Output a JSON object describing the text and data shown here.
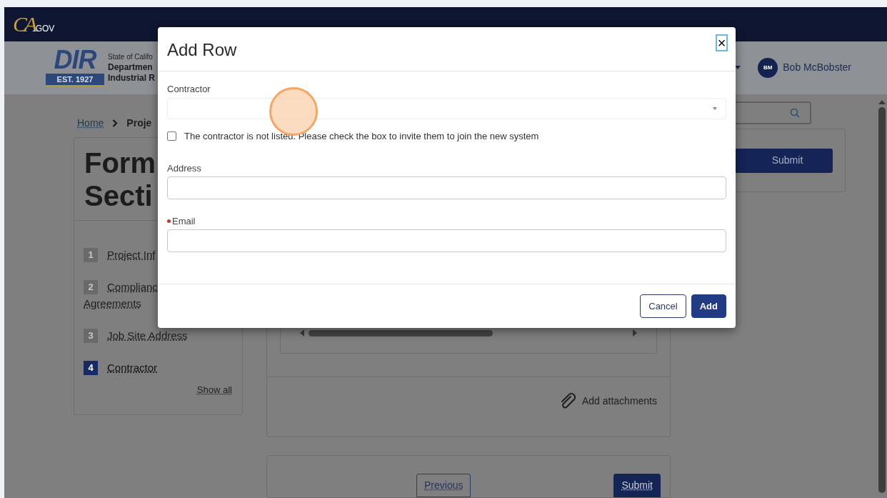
{
  "top_bar": {
    "logo": "CA",
    "logo_suffix": ".GOV"
  },
  "header": {
    "agency": {
      "letters": "DIR",
      "established": "EST. 1927",
      "lines": [
        "State of Califo",
        "Departmen",
        "Industrial R"
      ]
    },
    "user": {
      "initials": "BM",
      "name": "Bob McBobster"
    }
  },
  "breadcrumb": [
    "Home",
    "Proje"
  ],
  "form_title": [
    "Form",
    "Secti"
  ],
  "steps": [
    {
      "number": "1",
      "label": "Project Inf",
      "selected": false
    },
    {
      "number": "2",
      "label": "Complianc",
      "label_wrap": "Agreements",
      "selected": false
    },
    {
      "number": "3",
      "label": "Job Site Address",
      "selected": false
    },
    {
      "number": "4",
      "label": "Contractor",
      "selected": true
    }
  ],
  "show_all": "Show all",
  "side_panel": {
    "button": "Submit"
  },
  "attachments": "Add attachments",
  "nav_buttons": [
    {
      "label": "Previous",
      "primary": false
    },
    {
      "label": "Submit",
      "primary": true
    }
  ],
  "dialog": {
    "title": "Add Row",
    "close": "×",
    "fields": [
      {
        "kind": "select",
        "label": "Contractor",
        "required": false
      },
      {
        "kind": "checkbox",
        "label": "The contractor is not listed. Please check the box to invite them to join the new system",
        "checked": false
      },
      {
        "kind": "text",
        "label": "Address",
        "required": false
      },
      {
        "kind": "text",
        "label": "Email",
        "required": true
      }
    ],
    "buttons": [
      {
        "label": "Cancel",
        "primary": false
      },
      {
        "label": "Add",
        "primary": true
      }
    ]
  }
}
